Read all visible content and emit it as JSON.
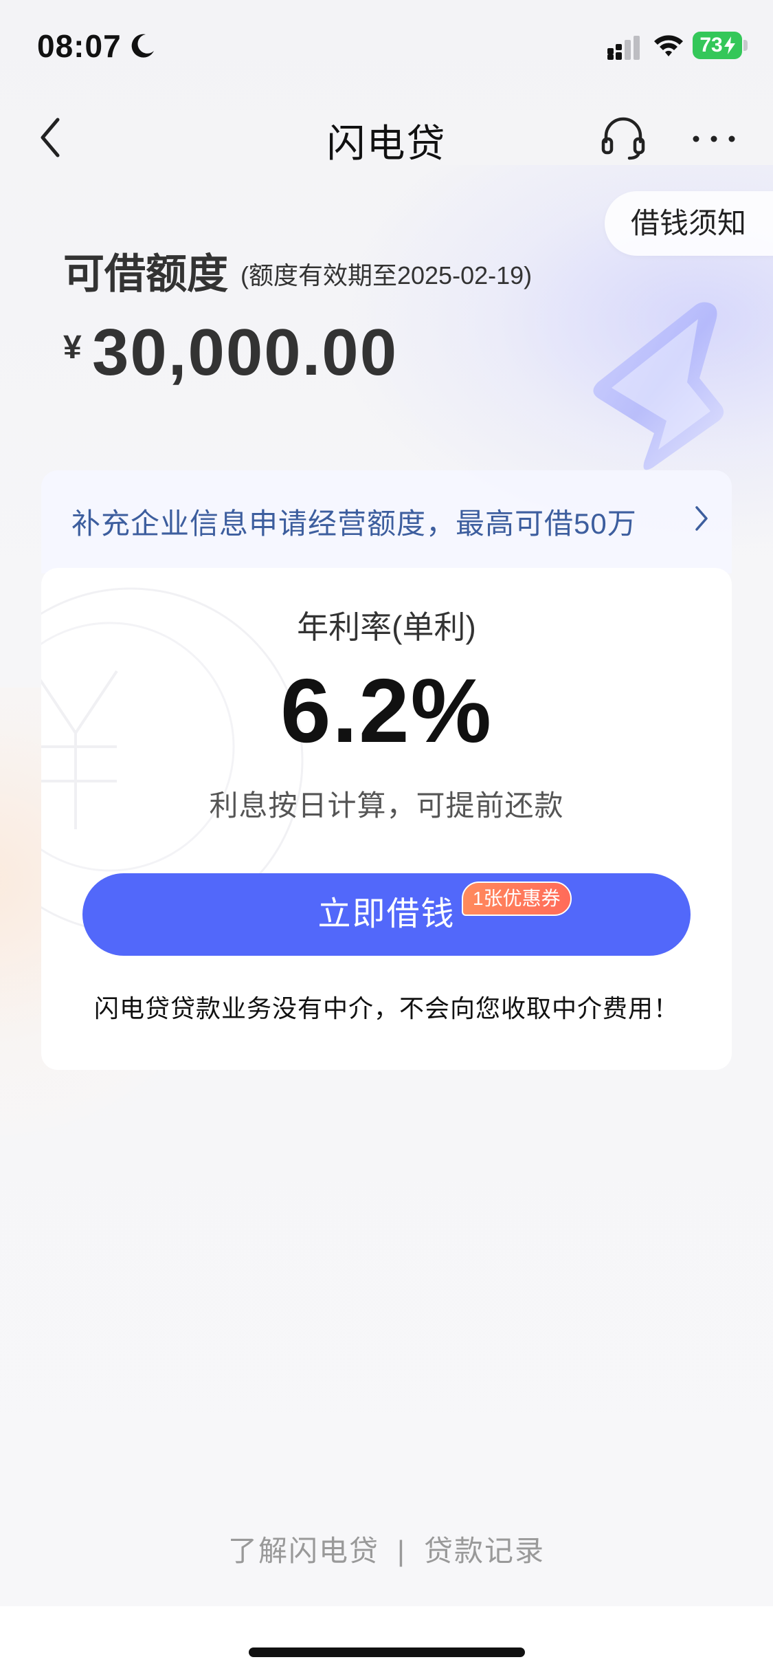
{
  "status_bar": {
    "time": "08:07",
    "battery": "73"
  },
  "nav": {
    "title": "闪电贷"
  },
  "notice": {
    "label": "借钱须知"
  },
  "credit": {
    "label": "可借额度",
    "validity": "(额度有效期至2025-02-19)",
    "currency": "¥",
    "amount": "30,000.00"
  },
  "enterprise_banner": {
    "text": "补充企业信息申请经营额度，最高可借50万"
  },
  "rate_card": {
    "rate_label": "年利率(单利)",
    "rate_value": "6.2%",
    "rate_note": "利息按日计算，可提前还款",
    "borrow_button": "立即借钱",
    "coupon_badge": "1张优惠券",
    "disclaimer": "闪电贷贷款业务没有中介，不会向您收取中介费用！"
  },
  "footer": {
    "about_link": "了解闪电贷",
    "separator": "|",
    "records_link": "贷款记录"
  },
  "colors": {
    "primary_button": "#5268fa",
    "banner_text": "#3d5e9e",
    "coupon": "#ff6b5a",
    "battery": "#34c759"
  },
  "icons": {
    "back": "chevron-left-icon",
    "service": "headset-icon",
    "more": "more-dots-icon",
    "enterprise_arrow": "chevron-right-icon"
  }
}
